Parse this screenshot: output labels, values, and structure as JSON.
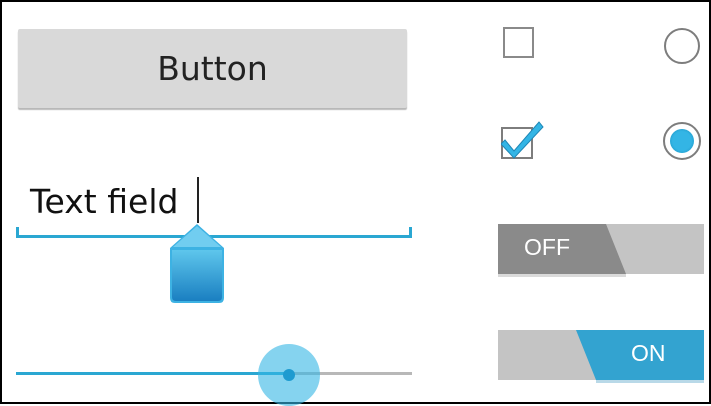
{
  "button": {
    "label": "Button"
  },
  "text_field": {
    "value": "Text field"
  },
  "seek_bar": {
    "progress_percent": 69
  },
  "checkboxes": [
    {
      "checked": false
    },
    {
      "checked": true
    }
  ],
  "radios": [
    {
      "selected": false
    },
    {
      "selected": true
    }
  ],
  "switches": [
    {
      "label": "OFF",
      "state": false
    },
    {
      "label": "ON",
      "state": true
    }
  ],
  "colors": {
    "accent": "#33b5e5",
    "accent_dark": "#1e9bd0",
    "button_bg": "#d9d9d9",
    "switch_off_thumb": "#8a8a8a",
    "switch_track": "#c4c4c4"
  },
  "icons": {
    "checkbox_checked": "checkmark-icon"
  }
}
